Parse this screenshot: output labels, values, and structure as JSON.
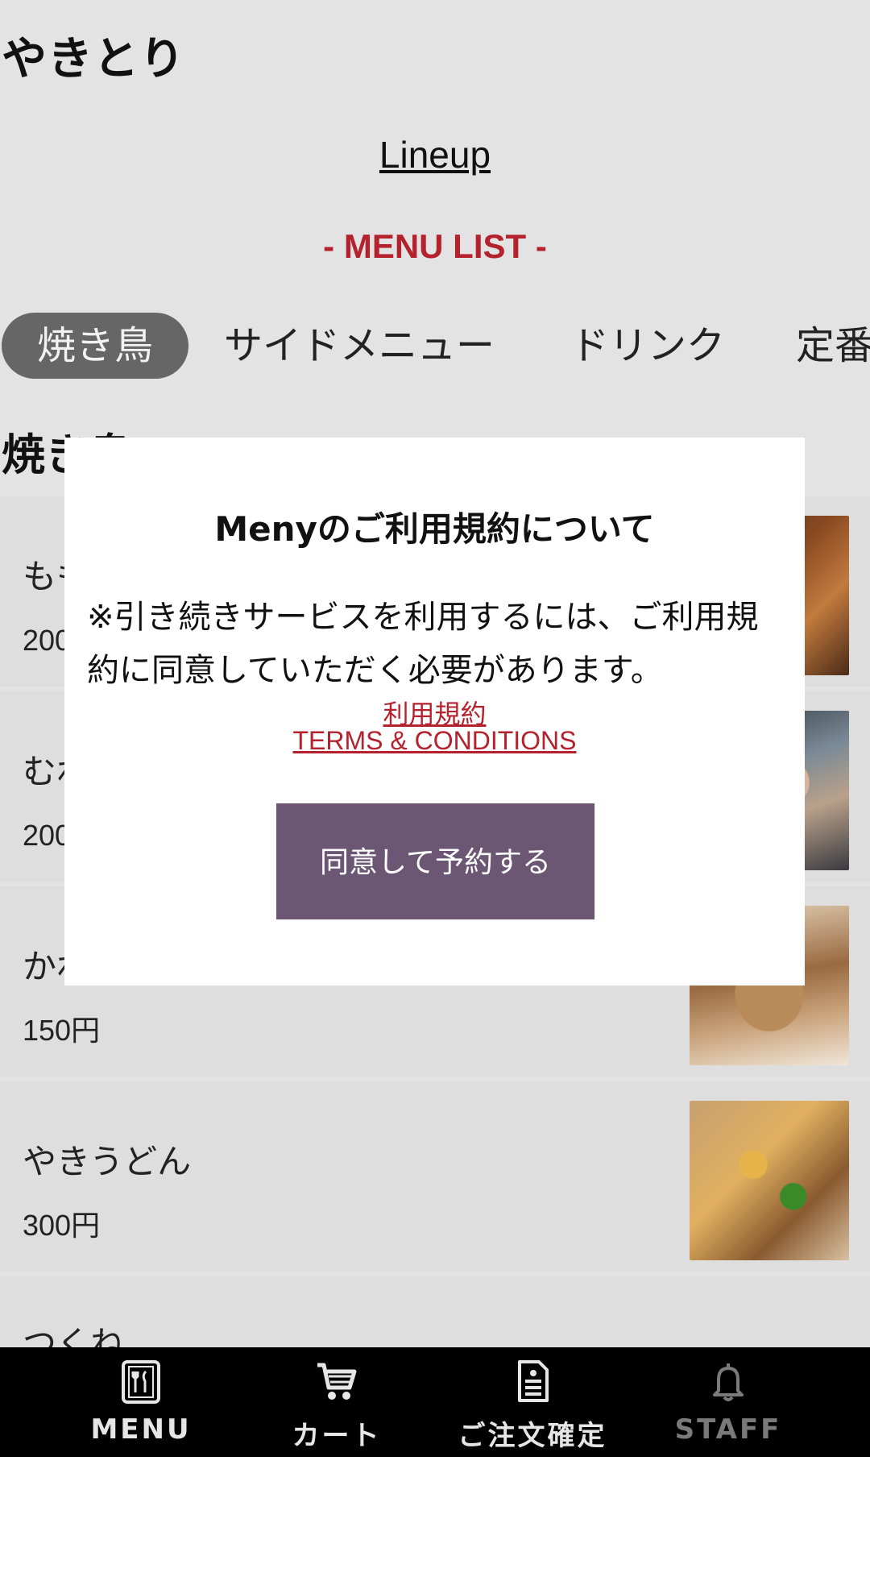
{
  "shop": {
    "title": "やきとり"
  },
  "header": {
    "lineup": "Lineup",
    "menu_list": "- MENU LIST -"
  },
  "tabs": [
    {
      "label": "焼き鳥",
      "active": true
    },
    {
      "label": "サイドメニュー"
    },
    {
      "label": "ドリンク"
    },
    {
      "label": "定番"
    }
  ],
  "section": {
    "title": "焼き鳥"
  },
  "items": [
    {
      "name": "もも",
      "price": "200円"
    },
    {
      "name": "むね",
      "price": "200円"
    },
    {
      "name": "かわ",
      "price": "150円"
    },
    {
      "name": "やきうどん",
      "price": "300円"
    },
    {
      "name": "つくね",
      "price": ""
    }
  ],
  "dialog": {
    "title": "Menyのご利用規約について",
    "body": "※引き続きサービスを利用するには、ご利用規約に同意していただく必要があります。",
    "terms_link_ja": "利用規約",
    "terms_link_en": "TERMS & CONDITIONS",
    "agree_button": "同意して予約する"
  },
  "bottom_nav": [
    {
      "label": "MENU",
      "icon": "menu-book-icon"
    },
    {
      "label": "カート",
      "icon": "cart-icon"
    },
    {
      "label": "ご注文確定",
      "icon": "order-confirm-icon"
    },
    {
      "label": "STAFF",
      "icon": "bell-icon"
    }
  ],
  "colors": {
    "accent_red": "#b3222d",
    "button_purple": "#6b5673",
    "tab_active": "#666666",
    "page_bg": "#e3e3e3",
    "nav_bg": "#000000"
  }
}
